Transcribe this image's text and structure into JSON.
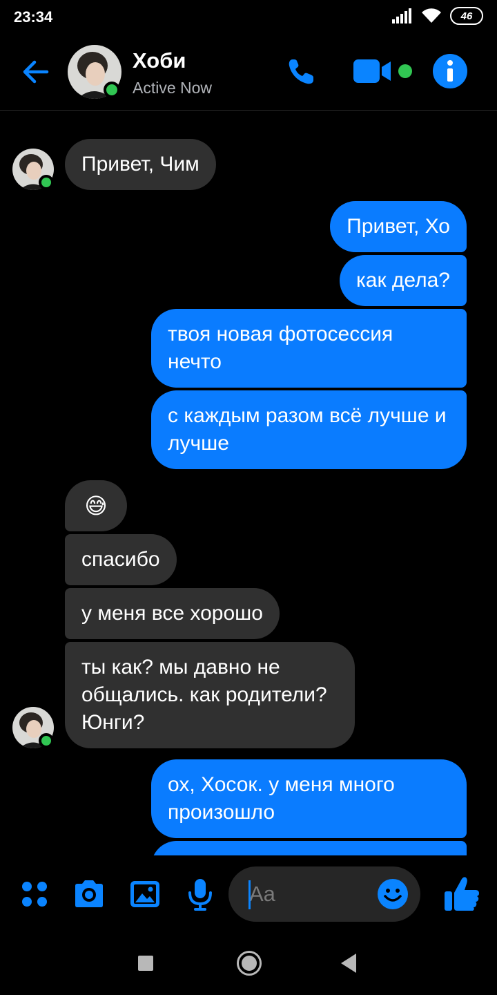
{
  "status_bar": {
    "time": "23:34",
    "battery": "46"
  },
  "header": {
    "name": "Хоби",
    "status": "Active Now"
  },
  "messages": [
    {
      "dir": "in",
      "text": "Привет, Чим"
    },
    {
      "dir": "out",
      "text": "Привет, Хо"
    },
    {
      "dir": "out",
      "text": "как дела?"
    },
    {
      "dir": "out",
      "text": "твоя новая фотосессия нечто"
    },
    {
      "dir": "out",
      "text": "с каждым разом всё лучше и лучше"
    },
    {
      "dir": "in",
      "text": "😅"
    },
    {
      "dir": "in",
      "text": "спасибо"
    },
    {
      "dir": "in",
      "text": "у меня все хорошо"
    },
    {
      "dir": "in",
      "text": "ты как? мы давно не общались. как родители? Юнги?"
    },
    {
      "dir": "out",
      "text": "ох, Хосок. у меня много произошло"
    },
    {
      "dir": "out",
      "text": ""
    }
  ],
  "composer": {
    "placeholder": "Aa"
  },
  "colors": {
    "accent": "#0a84ff",
    "outgoing": "#0a7cff",
    "incoming": "#303030",
    "online": "#31c653"
  },
  "icons": [
    "back-arrow-icon",
    "phone-icon",
    "video-camera-icon",
    "info-icon",
    "apps-icon",
    "camera-icon",
    "image-icon",
    "microphone-icon",
    "smiley-icon",
    "thumbs-up-icon"
  ]
}
